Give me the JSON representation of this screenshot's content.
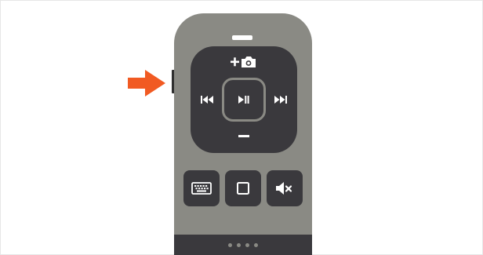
{
  "colors": {
    "arrow": "#f15a22",
    "remote_body": "#8a8a84",
    "control_dark": "#3a393d",
    "icon": "#ffffff"
  },
  "remote": {
    "top_slot_icon": "minus-bar-icon",
    "pad": {
      "up_icon": "add-camera-icon",
      "down_icon": "minus-icon",
      "left_icon": "previous-track-icon",
      "right_icon": "next-track-icon",
      "center_icon": "play-pause-icon"
    },
    "buttons": [
      {
        "name": "keyboard-button",
        "icon": "keyboard-icon"
      },
      {
        "name": "home-button",
        "icon": "square-icon"
      },
      {
        "name": "mute-button",
        "icon": "mute-icon"
      }
    ],
    "page_indicator": {
      "count": 4
    }
  },
  "callout": {
    "icon": "arrow-right-icon"
  }
}
